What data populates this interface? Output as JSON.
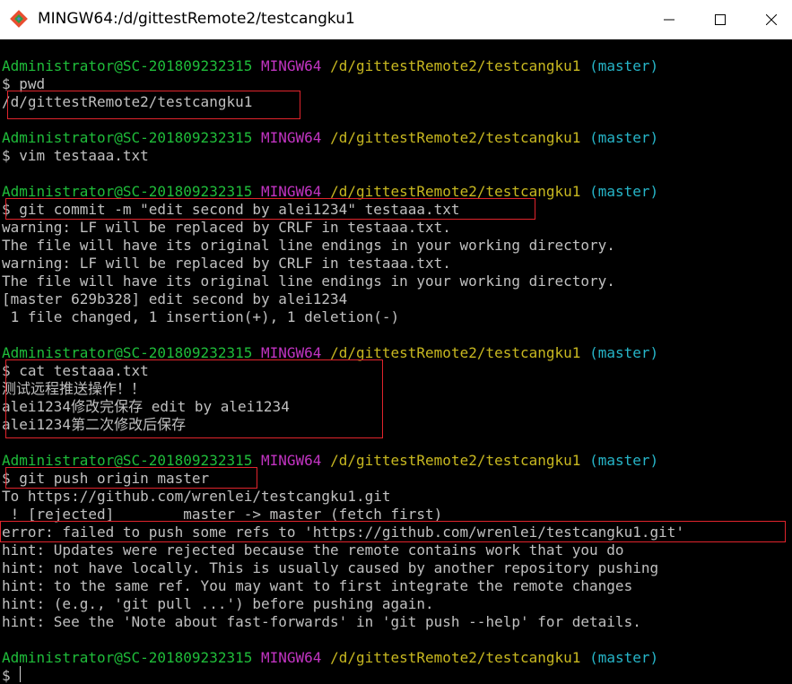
{
  "window": {
    "title": "MINGW64:/d/gittestRemote2/testcangku1",
    "colors": {
      "background": "#000000",
      "text": "#c0c0c0",
      "user": "#1fbd3a",
      "system": "#c234c2",
      "path": "#c8b820",
      "branch": "#26b5c8",
      "highlight": "#e0242c"
    },
    "icons": {
      "app": "git-diamond-icon",
      "minimize": "minimize-icon",
      "maximize": "maximize-icon",
      "close": "close-icon"
    }
  },
  "prompt": {
    "user": "Administrator@SC-201809232315",
    "system": "MINGW64",
    "path": "/d/gittestRemote2/testcangku1",
    "branch": "(master)"
  },
  "output": [
    "$ pwd",
    "/d/gittestRemote2/testcangku1",
    "$ vim testaaa.txt",
    "$ git commit -m \"edit second by alei1234\" testaaa.txt",
    "warning: LF will be replaced by CRLF in testaaa.txt.",
    "The file will have its original line endings in your working directory.",
    "warning: LF will be replaced by CRLF in testaaa.txt.",
    "The file will have its original line endings in your working directory.",
    "[master 629b328] edit second by alei1234",
    " 1 file changed, 1 insertion(+), 1 deletion(-)",
    "$ cat testaaa.txt",
    "测试远程推送操作！！",
    "alei1234修改完保存 edit by alei1234",
    "alei1234第二次修改后保存",
    "$ git push origin master",
    "To https://github.com/wrenlei/testcangku1.git",
    " ! [rejected]        master -> master (fetch first)",
    "error: failed to push some refs to 'https://github.com/wrenlei/testcangku1.git'",
    "hint: Updates were rejected because the remote contains work that you do",
    "hint: not have locally. This is usually caused by another repository pushing",
    "hint: to the same ref. You may want to first integrate the remote changes",
    "hint: (e.g., 'git pull ...') before pushing again.",
    "hint: See the 'Note about fast-forwards' in 'git push --help' for details.",
    "$ "
  ]
}
